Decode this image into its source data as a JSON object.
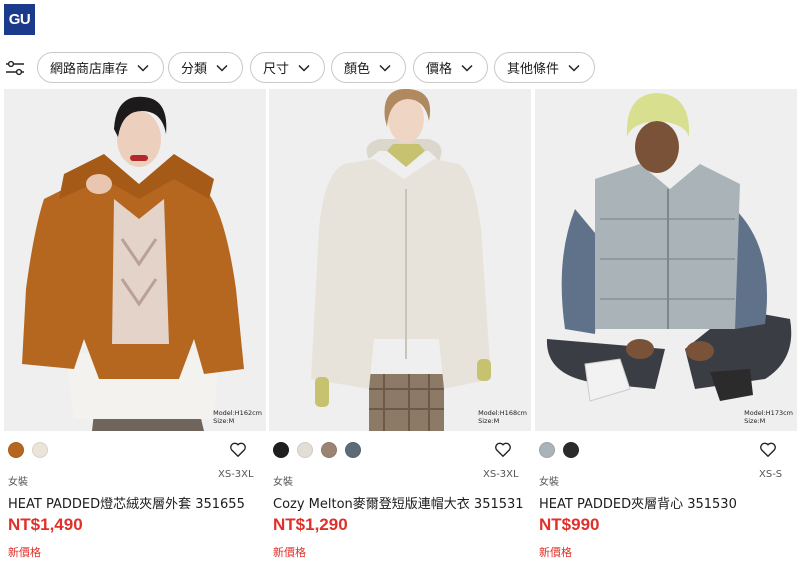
{
  "header": {
    "logo_text": "GU",
    "logo_color": "#1b3a8c"
  },
  "filters": {
    "icon": "filter-sliders-icon",
    "chips": [
      {
        "label": "網路商店庫存"
      },
      {
        "label": "分類"
      },
      {
        "label": "尺寸"
      },
      {
        "label": "顏色"
      },
      {
        "label": "價格"
      },
      {
        "label": "其他條件"
      }
    ]
  },
  "products": [
    {
      "category": "女裝",
      "sizes": "XS-3XL",
      "name": "HEAT PADDED燈芯絨夾層外套 351655",
      "price": "NT$1,490",
      "price_tag": "新價格",
      "colors": [
        "#b5671f",
        "#ece4d8"
      ],
      "model_info": [
        "Model:H162cm",
        "Size:M"
      ]
    },
    {
      "category": "女裝",
      "sizes": "XS-3XL",
      "name": "Cozy Melton麥爾登短版連帽大衣 351531",
      "price": "NT$1,290",
      "price_tag": "新價格",
      "colors": [
        "#1f1f1f",
        "#e2ded7",
        "#9c8474",
        "#5b6b78"
      ],
      "model_info": [
        "Model:H168cm",
        "Size:M"
      ]
    },
    {
      "category": "女裝",
      "sizes": "XS-S",
      "name": "HEAT PADDED夾層背心 351530",
      "price": "NT$990",
      "price_tag": "新價格",
      "colors": [
        "#a9b3b8",
        "#2b2b2b"
      ],
      "model_info": [
        "Model:H173cm",
        "Size:M"
      ]
    }
  ],
  "accent_price_color": "#e0302a"
}
